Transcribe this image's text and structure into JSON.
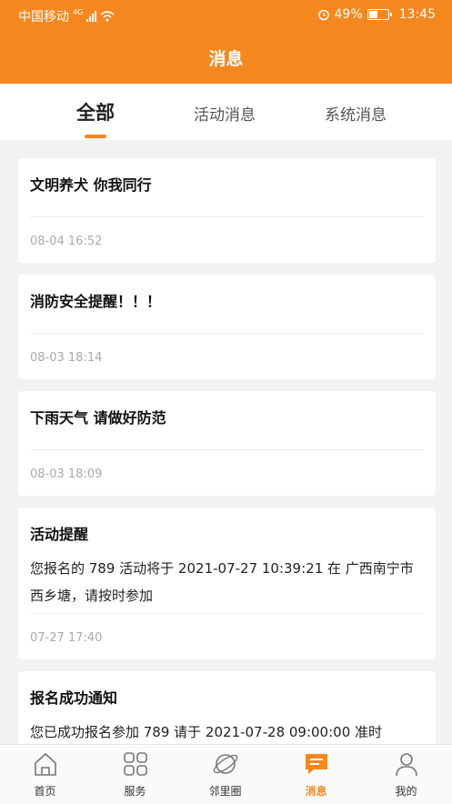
{
  "status_bar": {
    "carrier": "中国移动",
    "network": "4G",
    "battery": "49%",
    "battery_level": 0.49,
    "time": "13:45",
    "icons": [
      "signal-icon",
      "wifi-icon",
      "alarm-icon",
      "battery-icon"
    ]
  },
  "header": {
    "title": "消息"
  },
  "tabs": [
    {
      "label": "全部",
      "active": true
    },
    {
      "label": "活动消息",
      "active": false
    },
    {
      "label": "系统消息",
      "active": false
    }
  ],
  "messages": [
    {
      "title": "文明养犬 你我同行",
      "body": "",
      "time": "08-04 16:52"
    },
    {
      "title": "消防安全提醒！！！",
      "body": "",
      "time": "08-03 18:14"
    },
    {
      "title": "下雨天气 请做好防范",
      "body": "",
      "time": "08-03 18:09"
    },
    {
      "title": "活动提醒",
      "body": "您报名的 789 活动将于 2021-07-27 10:39:21 在 广西南宁市西乡塘，请按时参加",
      "time": "07-27 17:40"
    },
    {
      "title": "报名成功通知",
      "body": "您已成功报名参加 789 请于 2021-07-28 09:00:00 准时",
      "time": ""
    }
  ],
  "bottom_nav": [
    {
      "label": "首页",
      "icon": "home-icon",
      "active": false
    },
    {
      "label": "服务",
      "icon": "grid-icon",
      "active": false
    },
    {
      "label": "邻里圈",
      "icon": "planet-icon",
      "active": false
    },
    {
      "label": "消息",
      "icon": "message-icon",
      "active": true
    },
    {
      "label": "我的",
      "icon": "user-icon",
      "active": false
    }
  ],
  "colors": {
    "accent": "#f5871f",
    "background": "#f2f2f2",
    "muted_text": "#aaaaaa"
  }
}
